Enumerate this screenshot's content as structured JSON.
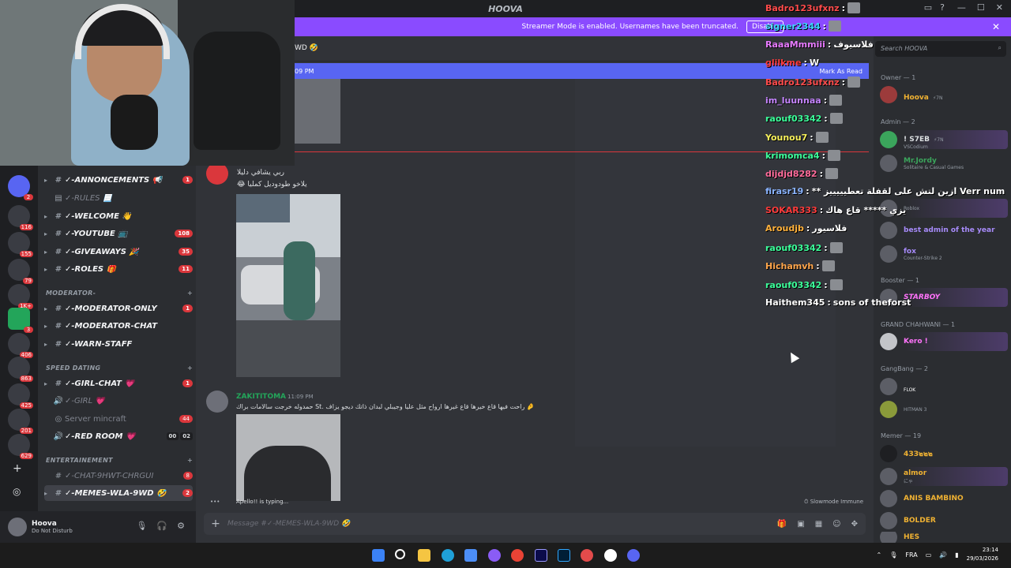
{
  "titlebar": {
    "title": "HOOVA"
  },
  "banner": {
    "text": "Streamer Mode is enabled. Usernames have been truncated.",
    "button": "Disable",
    "close": "✕"
  },
  "channel_header": {
    "name": "WD",
    "new_time": "09 PM",
    "mark_read": "Mark As Read"
  },
  "servers": [
    {
      "badge": "2"
    },
    {
      "badge": "116"
    },
    {
      "badge": "155"
    },
    {
      "badge": "79"
    },
    {
      "badge": "1K+"
    },
    {
      "badge": "3"
    },
    {
      "badge": "406"
    },
    {
      "badge": "863"
    },
    {
      "badge": "425"
    },
    {
      "badge": "201"
    },
    {
      "badge": "629"
    }
  ],
  "sidebar": {
    "channels": [
      {
        "name": "✓-ANNONCEMENTS 📢",
        "count": "1",
        "type": "#"
      },
      {
        "name": "✓-RULES 📃",
        "count": "",
        "type": "▤"
      },
      {
        "name": "✓-WELCOME 👋",
        "count": "",
        "type": "#"
      },
      {
        "name": "✓-YOUTUBE 📺",
        "count": "108",
        "type": "#"
      },
      {
        "name": "✓-GIVEAWAYS 🎉",
        "count": "35",
        "type": "#"
      },
      {
        "name": "✓-ROLES 🎁",
        "count": "11",
        "type": "#"
      },
      {
        "name": "✓-MODERATOR-ONLY",
        "count": "1",
        "type": "#"
      },
      {
        "name": "✓-MODERATOR-CHAT",
        "count": "",
        "type": "#"
      },
      {
        "name": "✓-WARN-STAFF",
        "count": "",
        "type": "#"
      },
      {
        "name": "✓-GIRL-CHAT 💗",
        "count": "1",
        "type": "#"
      },
      {
        "name": "✓-GIRL 💗",
        "count": "",
        "type": "🔊"
      },
      {
        "name": "Server mincraft",
        "count": "44",
        "type": "◎"
      },
      {
        "name": "✓-RED ROOM 💗",
        "count": "",
        "type": "🔊"
      },
      {
        "name": "✓-CHAT-9HWT-CHRGUI",
        "count": "8",
        "type": "#"
      },
      {
        "name": "✓-MEMES-WLA-9WD 🤣",
        "count": "2",
        "type": "#"
      }
    ],
    "categories": [
      "MODERATOR-",
      "SPEED DATING",
      "ENTERTAINEMENT"
    ],
    "voice_counts": [
      "00",
      "02"
    ]
  },
  "user": {
    "name": "Hoova",
    "status": "Do Not Disturb"
  },
  "messages": [
    {
      "text1": "ربي يشافي دليلا",
      "text2": "😂 يلاخو طودوديل كمليا"
    },
    {
      "author": "ZAKITITOMA",
      "time": "11:09 PM",
      "text": "حمدوله خرجت سالامات براك St.  راحت فيها قاع خيرها قاع غيرها ارواح مثل عليا وجيبلي لبدان ذاتك ديجو يزاف 🤌"
    }
  ],
  "typing": "Apello!! is typing...",
  "slowmode": "Slowmode Immune",
  "input_placeholder": "Message #✓-MEMES-WLA-9WD 🤣",
  "twitch_chat": [
    {
      "user": "Badro123ufxnz",
      "color": "#ff4b4b",
      "msg": "",
      "emote": true
    },
    {
      "user": "signer2344",
      "color": "#3ad7ff",
      "msg": "",
      "emote": true
    },
    {
      "user": "RaaaMmmiii",
      "color": "#e77bff",
      "msg": "فلاسيوف",
      "emote": false
    },
    {
      "user": "glilkme",
      "color": "#ff3b3b",
      "msg": "W",
      "emote": false
    },
    {
      "user": "Badro123ufxnz",
      "color": "#ff4b4b",
      "msg": "",
      "emote": true
    },
    {
      "user": "im_luunnaa",
      "color": "#c685ff",
      "msg": "",
      "emote": true
    },
    {
      "user": "raouf03342",
      "color": "#3bff9a",
      "msg": "",
      "emote": true
    },
    {
      "user": "Younou7",
      "color": "#f7f05a",
      "msg": "",
      "emote": true
    },
    {
      "user": "krimomca4",
      "color": "#3bff9a",
      "msg": "",
      "emote": true
    },
    {
      "user": "dijdjd8282",
      "color": "#ff6b9a",
      "msg": "",
      "emote": true
    },
    {
      "user": "firasr19",
      "color": "#8ab4ff",
      "msg": "** ازين لتش على لقفلة تعطيييييز Verr num",
      "emote": false
    },
    {
      "user": "SOKAR333",
      "color": "#ff3b3b",
      "msg": "يزي ***** قاع هاك",
      "emote": false
    },
    {
      "user": "Aroudjb",
      "color": "#ffb13b",
      "msg": "فلاسيور",
      "emote": false
    },
    {
      "user": "raouf03342",
      "color": "#3bff9a",
      "msg": "",
      "emote": true
    },
    {
      "user": "Hichamvh",
      "color": "#ffa64b",
      "msg": "",
      "emote": true
    },
    {
      "user": "raouf03342",
      "color": "#3bff9a",
      "msg": "",
      "emote": true
    },
    {
      "user": "Haithem345",
      "color": "#ffffff",
      "msg": "sons of theforst",
      "emote": false
    }
  ],
  "members": {
    "search_placeholder": "Search HOOVA",
    "groups": [
      {
        "label": "Owner — 1"
      },
      {
        "label": "Admin — 2"
      },
      {
        "label": "Booster — 1"
      },
      {
        "label": "GRAND CHAHWANI — 1"
      },
      {
        "label": "GangBang — 2"
      },
      {
        "label": "Memer — 19"
      }
    ],
    "list": [
      {
        "name": "Hoova",
        "tag": "⚡7N",
        "sub": "",
        "color": "#f0b232"
      },
      {
        "name": "! S7EB",
        "tag": "⚡7N",
        "sub": "VSCodium",
        "color": "#ffffff"
      },
      {
        "name": "Mr.Jordy",
        "tag": "",
        "sub": "Solitaire & Casual Games",
        "color": "#3ba55c"
      },
      {
        "name": "",
        "tag": "",
        "sub": "Roblox",
        "color": "#ffffff"
      },
      {
        "name": "best admin of the year",
        "tag": "",
        "sub": "",
        "color": "#a78bfa"
      },
      {
        "name": "fox",
        "tag": "",
        "sub": "Counter-Strike 2",
        "color": "#a78bfa"
      },
      {
        "name": "STARBOY",
        "tag": "",
        "sub": "",
        "color": "#ff73fa"
      },
      {
        "name": "Kero !",
        "tag": "",
        "sub": "",
        "color": "#ff73fa"
      },
      {
        "name": "",
        "tag": "FLOK",
        "sub": "",
        "color": "#ffffff"
      },
      {
        "name": "",
        "tag": "",
        "sub": "HITMAN 3",
        "color": "#ffffff"
      },
      {
        "name": "4ЗЗ๒๒๒",
        "tag": "",
        "sub": "",
        "color": "#f0b232"
      },
      {
        "name": "almor",
        "tag": "",
        "sub": "にゃ",
        "color": "#f0b232"
      },
      {
        "name": "ANIS BAMBINO",
        "tag": "",
        "sub": "",
        "color": "#f0b232"
      },
      {
        "name": "BOLDER",
        "tag": "",
        "sub": "",
        "color": "#f0b232"
      },
      {
        "name": "HES",
        "tag": "",
        "sub": "",
        "color": "#f0b232"
      }
    ]
  },
  "taskbar": {
    "lang": "FRA",
    "time": "23:14",
    "date": "29/03/2026"
  }
}
